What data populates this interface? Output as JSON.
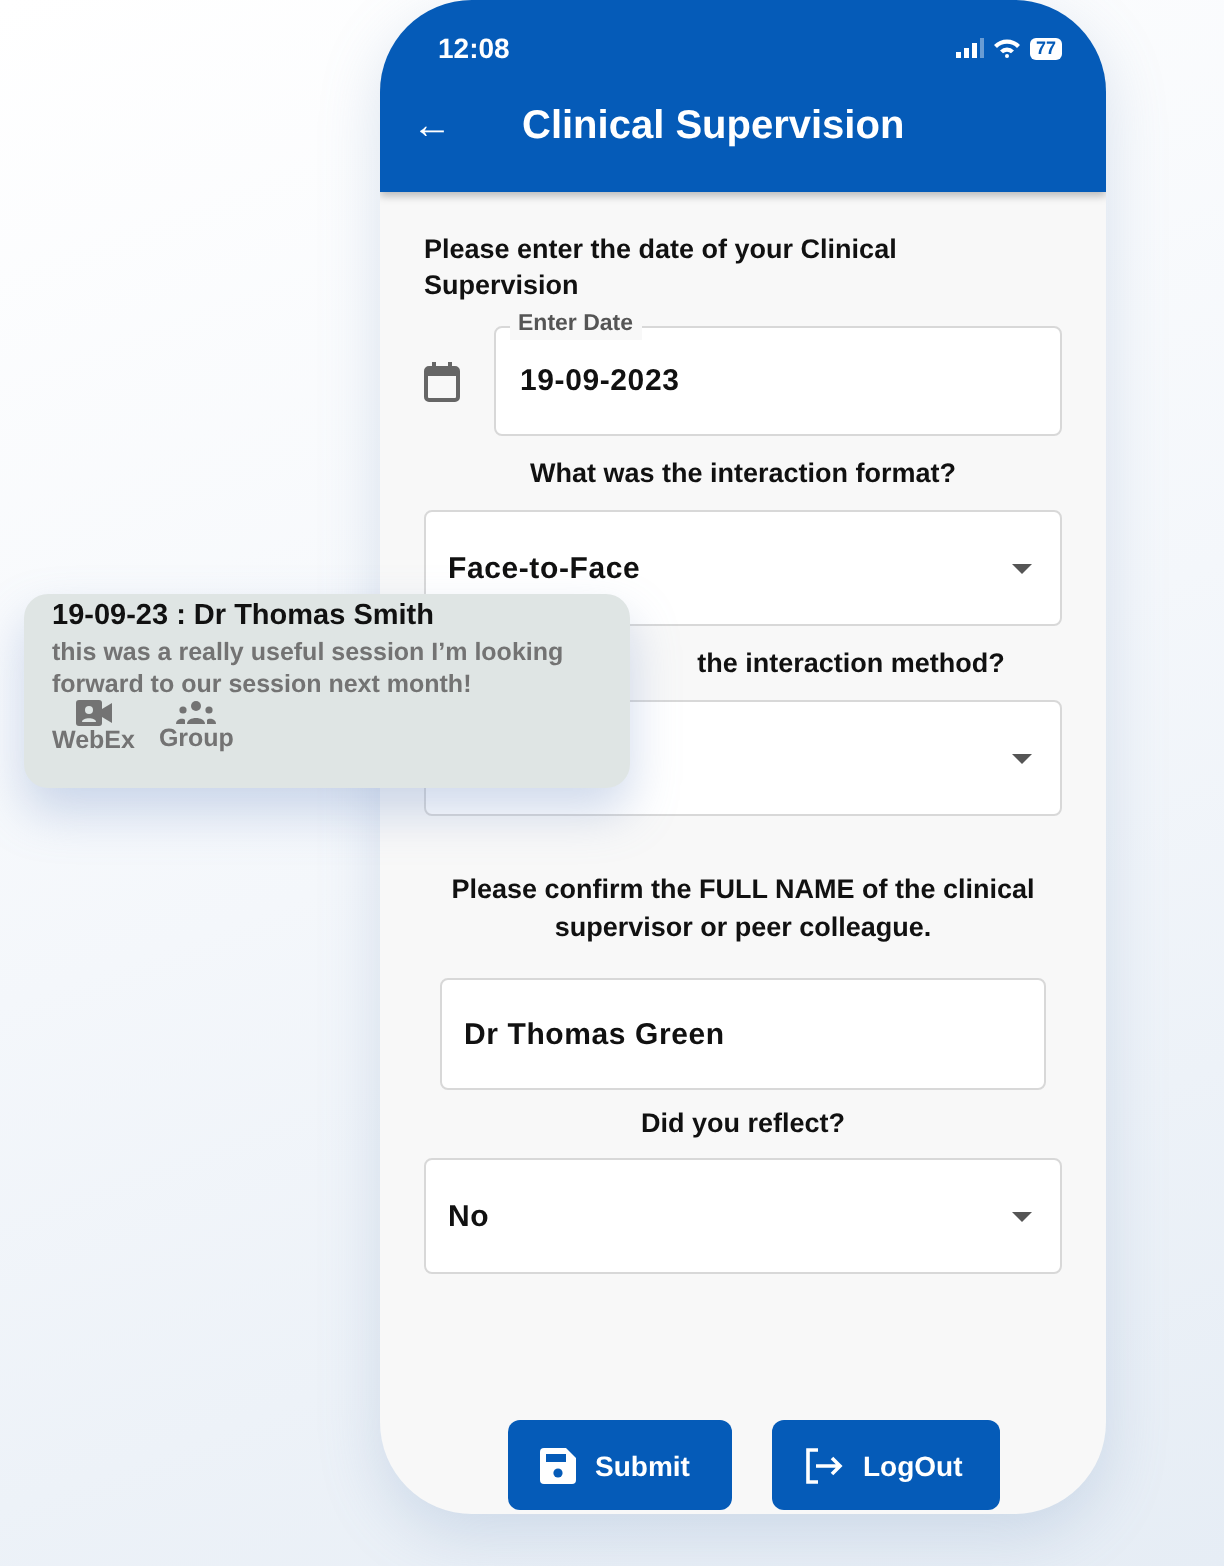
{
  "status_bar": {
    "time": "12:08",
    "battery": "77"
  },
  "app_bar": {
    "back": "←",
    "title": "Clinical Supervision"
  },
  "form": {
    "date_question": "Please enter the date of your Clinical Supervision",
    "date_field": {
      "label": "Enter Date",
      "value": "19-09-2023"
    },
    "format_question": "What was the interaction format?",
    "format_select": {
      "value": "Face-to-Face"
    },
    "method_question": "the interaction method?",
    "name_question": "Please confirm the FULL NAME of the clinical supervisor or peer colleague.",
    "name_field": {
      "value": "Dr Thomas Green"
    },
    "reflect_question": "Did you reflect?",
    "reflect_select": {
      "value": "No"
    }
  },
  "buttons": [
    {
      "kind": "save",
      "label": "Submit"
    },
    {
      "kind": "logout",
      "label": "LogOut"
    }
  ],
  "note_card": {
    "title": "19-09-23 : Dr Thomas Smith",
    "text": "this was a really useful session  I’m looking forward to our session next month!",
    "tags": [
      {
        "kind": "video",
        "label": "WebEx"
      },
      {
        "kind": "group",
        "label": "Group"
      }
    ]
  }
}
